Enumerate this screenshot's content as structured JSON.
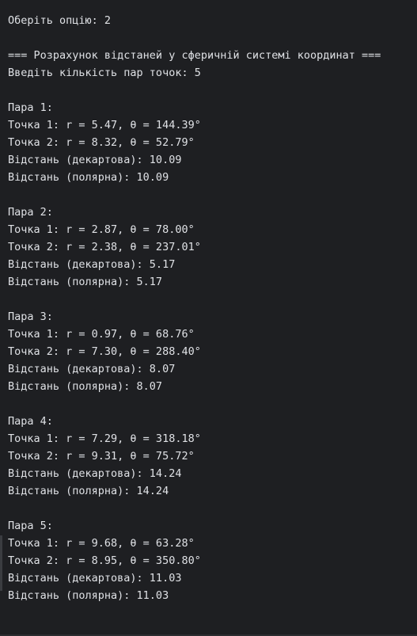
{
  "terminal": {
    "lines": [
      "Оберіть опцію: 2",
      "",
      "=== Розрахунок відстаней у сферичній системі координат ===",
      "Введіть кількість пар точок: 5",
      "",
      "Пара 1:",
      "Точка 1: r = 5.47, θ = 144.39°",
      "Точка 2: r = 8.32, θ = 52.79°",
      "Відстань (декартова): 10.09",
      "Відстань (полярна): 10.09",
      "",
      "Пара 2:",
      "Точка 1: r = 2.87, θ = 78.00°",
      "Точка 2: r = 2.38, θ = 237.01°",
      "Відстань (декартова): 5.17",
      "Відстань (полярна): 5.17",
      "",
      "Пара 3:",
      "Точка 1: r = 0.97, θ = 68.76°",
      "Точка 2: r = 7.30, θ = 288.40°",
      "Відстань (декартова): 8.07",
      "Відстань (полярна): 8.07",
      "",
      "Пара 4:",
      "Точка 1: r = 7.29, θ = 318.18°",
      "Точка 2: r = 9.31, θ = 75.72°",
      "Відстань (декартова): 14.24",
      "Відстань (полярна): 14.24",
      "",
      "Пара 5:",
      "Точка 1: r = 9.68, θ = 63.28°",
      "Точка 2: r = 8.95, θ = 350.80°",
      "Відстань (декартова): 11.03",
      "Відстань (полярна): 11.03"
    ]
  },
  "colors": {
    "background": "#1e1f22",
    "text": "#dfe1e5"
  }
}
